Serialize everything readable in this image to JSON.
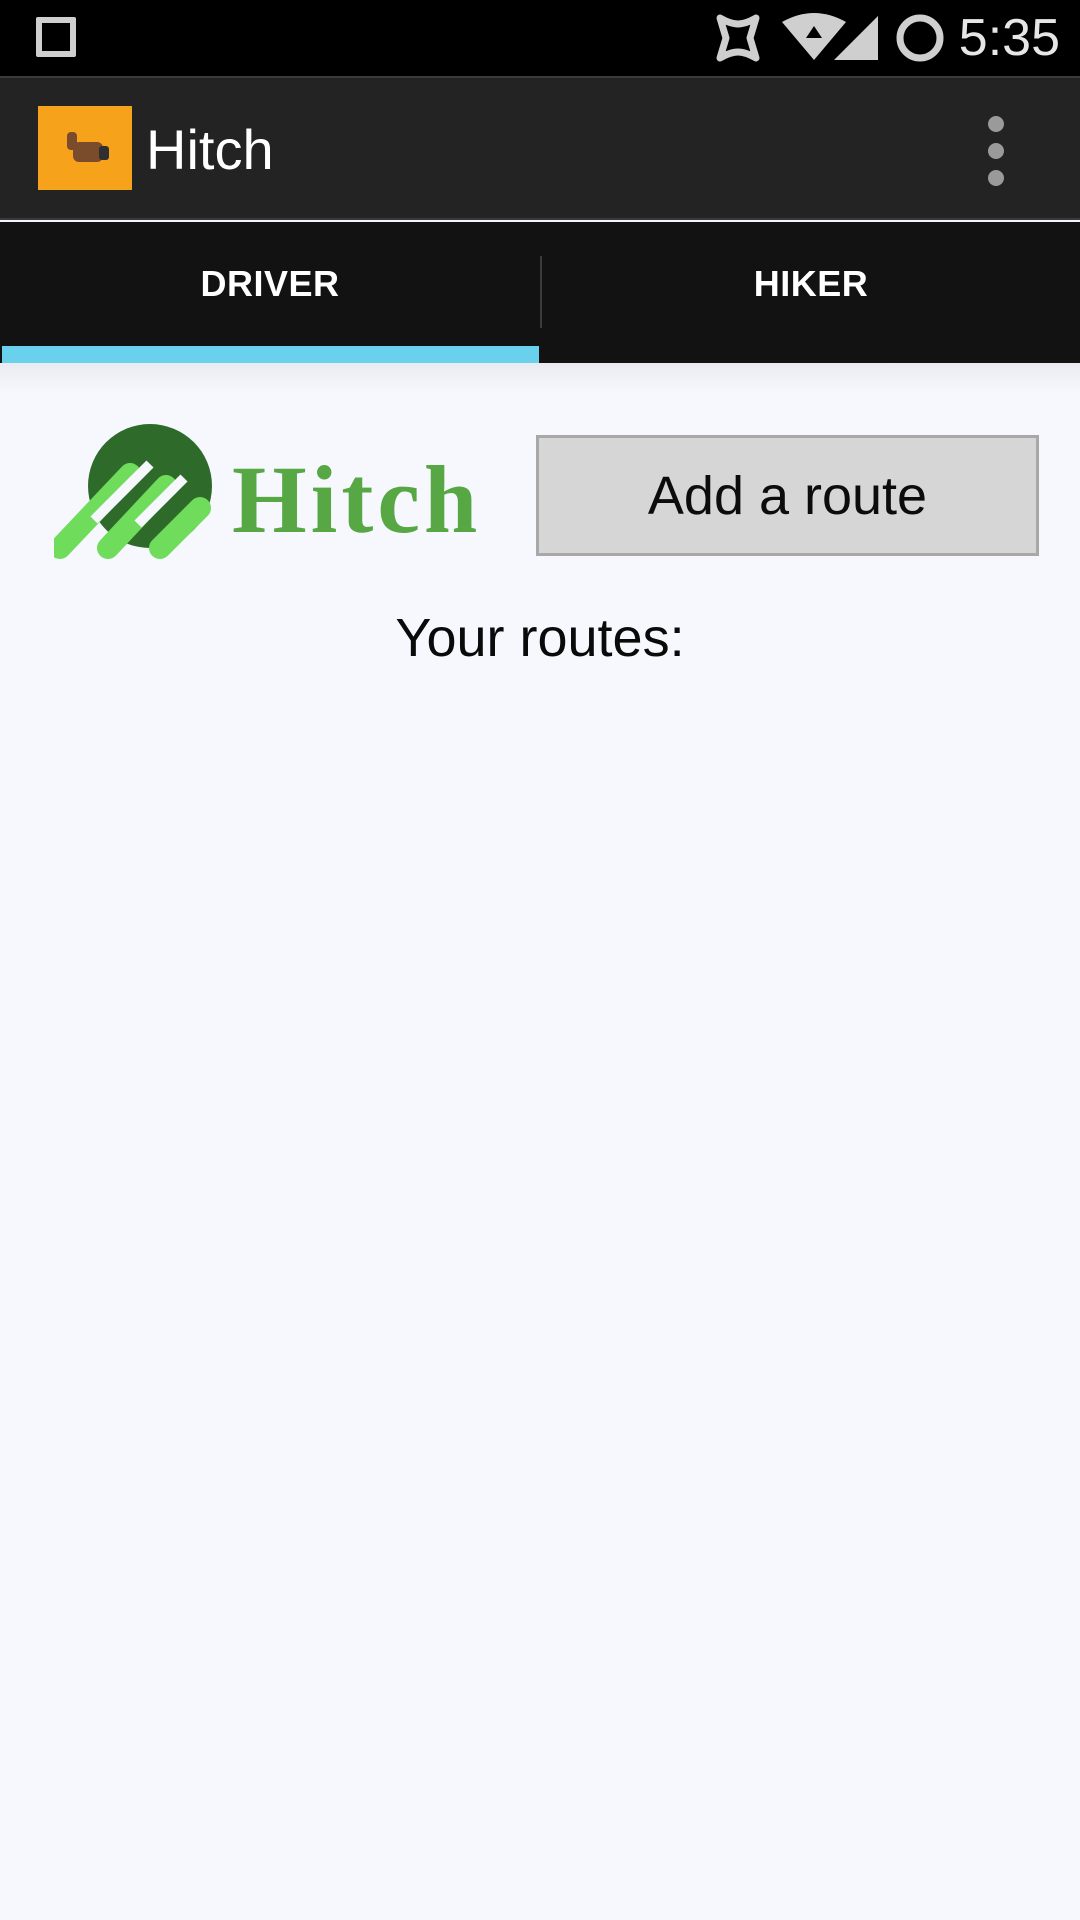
{
  "status_bar": {
    "time": "5:35",
    "icons": [
      "square-icon",
      "sync-icon",
      "wifi-icon",
      "signal-icon",
      "circle-status-icon"
    ]
  },
  "app_bar": {
    "title": "Hitch",
    "app_icon": "thumbs-up-icon",
    "menu_icon": "overflow-menu-icon",
    "accent": "#f6a21b"
  },
  "tabs": [
    {
      "label": "DRIVER",
      "selected": true
    },
    {
      "label": "HIKER",
      "selected": false
    }
  ],
  "tab_indicator_color": "#6ad1ec",
  "main": {
    "logo_text": "Hitch",
    "add_route_label": "Add a route",
    "routes_heading": "Your routes:"
  }
}
